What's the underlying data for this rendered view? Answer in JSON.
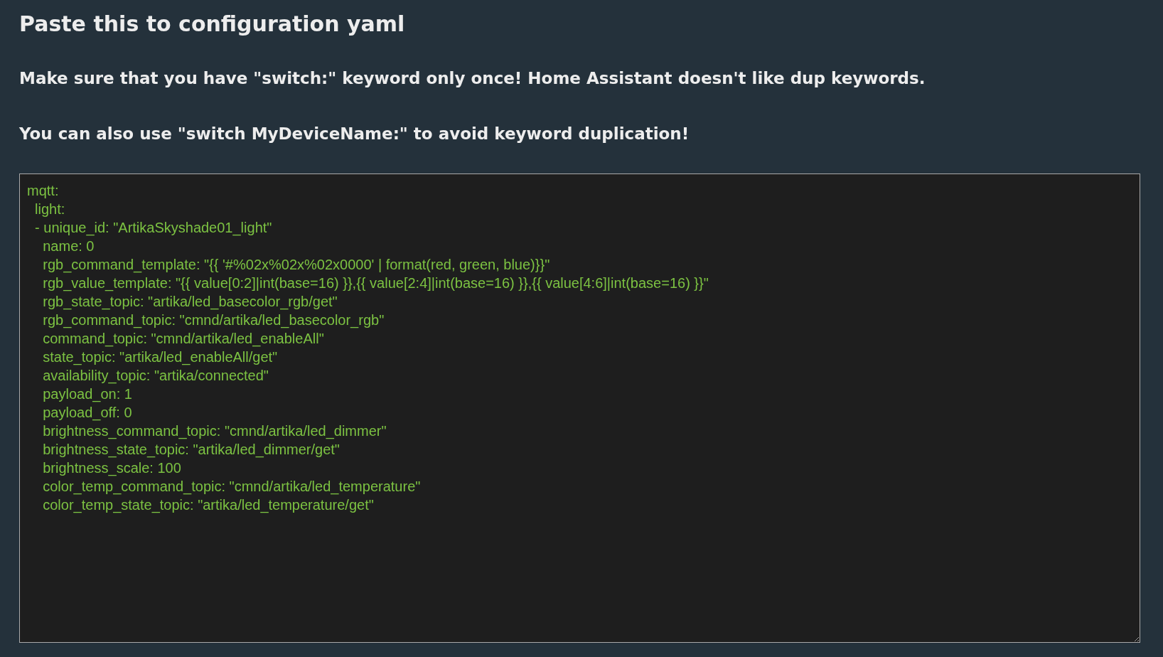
{
  "title": "Paste this to configuration yaml",
  "notes": [
    "Make sure that you have \"switch:\" keyword only once! Home Assistant doesn't like dup keywords.",
    "You can also use \"switch MyDeviceName:\" to avoid keyword duplication!"
  ],
  "config_text": {
    "value": [
      "mqtt:",
      "  light:",
      "  - unique_id: \"ArtikaSkyshade01_light\"",
      "    name: 0",
      "    rgb_command_template: \"{{ '#%02x%02x%02x0000' | format(red, green, blue)}}\"",
      "    rgb_value_template: \"{{ value[0:2]|int(base=16) }},{{ value[2:4]|int(base=16) }},{{ value[4:6]|int(base=16) }}\"",
      "    rgb_state_topic: \"artika/led_basecolor_rgb/get\"",
      "    rgb_command_topic: \"cmnd/artika/led_basecolor_rgb\"",
      "    command_topic: \"cmnd/artika/led_enableAll\"",
      "    state_topic: \"artika/led_enableAll/get\"",
      "    availability_topic: \"artika/connected\"",
      "    payload_on: 1",
      "    payload_off: 0",
      "    brightness_command_topic: \"cmnd/artika/led_dimmer\"",
      "    brightness_state_topic: \"artika/led_dimmer/get\"",
      "    brightness_scale: 100",
      "    color_temp_command_topic: \"cmnd/artika/led_temperature\"",
      "    color_temp_state_topic: \"artika/led_temperature/get\""
    ]
  }
}
